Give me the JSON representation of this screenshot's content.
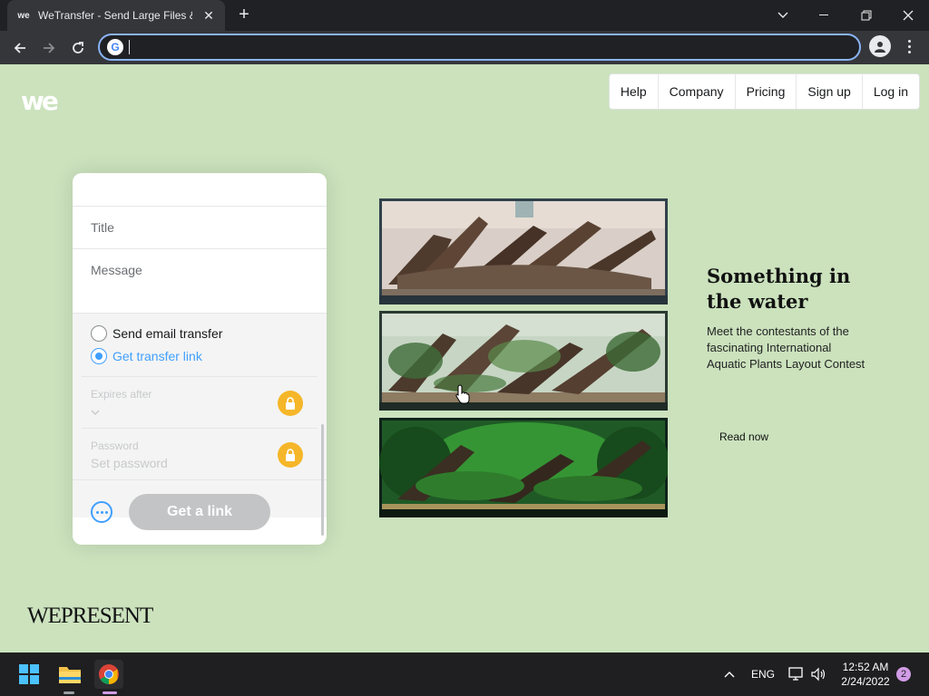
{
  "browser": {
    "tab_title": "WeTransfer - Send Large Files & Share Photos Online",
    "url": ""
  },
  "site": {
    "nav": [
      "Help",
      "Company",
      "Pricing",
      "Sign up",
      "Log in"
    ]
  },
  "form": {
    "title_placeholder": "Title",
    "message_placeholder": "Message",
    "option_email": "Send email transfer",
    "option_link": "Get transfer link",
    "selected_option": "link",
    "expires_label": "Expires after",
    "password_label": "Password",
    "password_placeholder": "Set password",
    "submit_label": "Get a link"
  },
  "feature": {
    "headline": "Something in the water",
    "description": "Meet the contestants of the fascinating International Aquatic Plants Layout Contest",
    "cta": "Read now",
    "brand": "WEPRESENT"
  },
  "taskbar": {
    "language": "ENG",
    "time": "12:52 AM",
    "date": "2/24/2022",
    "notifications": "2"
  },
  "colors": {
    "page_bg": "#cbe2bd",
    "accent": "#409fff",
    "lock": "#f5b629"
  }
}
